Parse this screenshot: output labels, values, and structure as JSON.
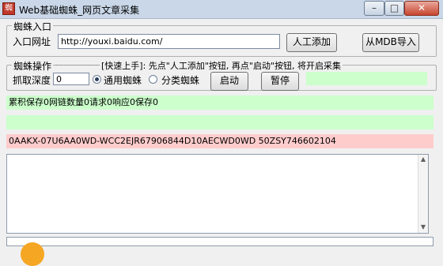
{
  "window": {
    "title": "Web基础蜘蛛_网页文章采集",
    "icon_text": "蜘",
    "minimize": "–",
    "maximize": "□",
    "close": "✕"
  },
  "entry_group": {
    "legend": "蜘蛛入口",
    "url_label": "入口网址",
    "url_value": "http://youxi.baidu.com/",
    "add_button": "人工添加",
    "import_button": "从MDB导入"
  },
  "spider_group": {
    "legend": "蜘蛛操作",
    "tip": "[快速上手]: 先点\"人工添加\"按钮, 再点\"启动\"按钮, 将开启采集",
    "depth_label": "抓取深度",
    "depth_value": "0",
    "radio_general": "通用蜘蛛",
    "radio_category": "分类蜘蛛",
    "start_button": "启动",
    "pause_button": "暂停"
  },
  "status": {
    "stats_line": "累积保存0网链数量0请求0响应0保存0",
    "blank_line": "",
    "key_line": "0AAKX-07U6AA0WD-WCC2EJR67906844D10AECWD0WD 50ZSY746602104"
  },
  "colors": {
    "status_green": "#ccffcc",
    "status_pink": "#ffcccc",
    "titlebar": "#c9d7e8"
  }
}
